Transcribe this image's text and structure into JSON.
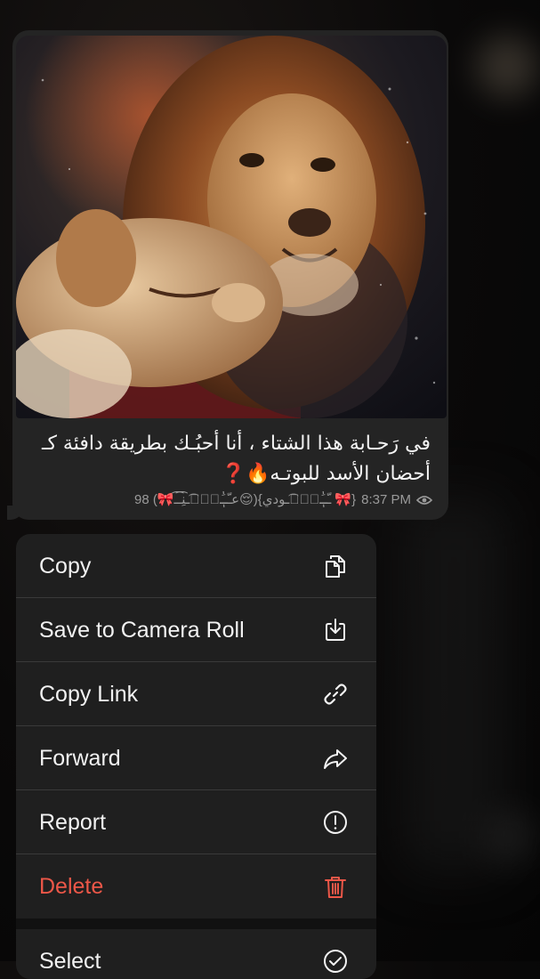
{
  "message": {
    "caption": "في رَحـابة هذا الشتاء ، أنا أحبُـك بطريقة دافئة كـ أحضان الأسد للبوتـه🔥❓",
    "reactions_meta": "98 (🎀عـّـَٰٖـّۢ͡ـنِ͡ـ͡ـ😌){ـّـَٰٖـّۢ͡ـودي 🎀}",
    "time": "8:37 PM",
    "photo_alt": "lion and lioness"
  },
  "menu": {
    "items": [
      {
        "label": "Copy",
        "icon": "copy-icon"
      },
      {
        "label": "Save to Camera Roll",
        "icon": "save-download-icon"
      },
      {
        "label": "Copy Link",
        "icon": "link-icon"
      },
      {
        "label": "Forward",
        "icon": "forward-arrow-icon"
      },
      {
        "label": "Report",
        "icon": "report-exclamation-icon"
      },
      {
        "label": "Delete",
        "icon": "trash-icon"
      },
      {
        "label": "Select",
        "icon": "checkmark-circle-icon"
      }
    ]
  },
  "colors": {
    "delete_red": "#ec5748",
    "bubble_bg": "#242424",
    "menu_bg": "#202020"
  }
}
